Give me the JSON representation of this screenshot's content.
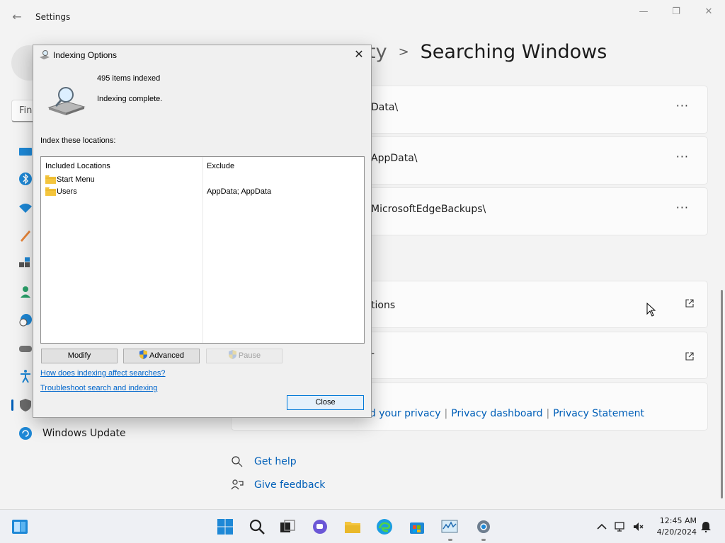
{
  "settings": {
    "app_title": "Settings",
    "breadcrumb": {
      "prev": "ty",
      "separator": ">",
      "current": "Searching Windows"
    },
    "search_placeholder": "Fin",
    "nav_visible_label": "Windows Update",
    "excluded_folders": [
      {
        "path": "Data\\"
      },
      {
        "path": "AppData\\"
      },
      {
        "path": "MicrosoftEdgeBackups\\"
      }
    ],
    "more_label": "···",
    "advanced_link_label": "tions",
    "second_link_label": "-",
    "privacy_links": [
      "nd your privacy",
      "Privacy dashboard",
      "Privacy Statement"
    ],
    "help": {
      "get_help": "Get help",
      "give_feedback": "Give feedback"
    },
    "accent": "#005fb8"
  },
  "dialog": {
    "title": "Indexing Options",
    "items_indexed": "495 items indexed",
    "status": "Indexing complete.",
    "section_label": "Index these locations:",
    "columns": {
      "included": "Included Locations",
      "exclude": "Exclude"
    },
    "rows": [
      {
        "location": "Start Menu",
        "exclude": ""
      },
      {
        "location": "Users",
        "exclude": "AppData; AppData"
      }
    ],
    "buttons": {
      "modify": "Modify",
      "advanced": "Advanced",
      "pause": "Pause",
      "close": "Close"
    },
    "links": {
      "how": "How does indexing affect searches?",
      "troubleshoot": "Troubleshoot search and indexing"
    }
  },
  "taskbar": {
    "time": "12:45 AM",
    "date": "4/20/2024"
  }
}
